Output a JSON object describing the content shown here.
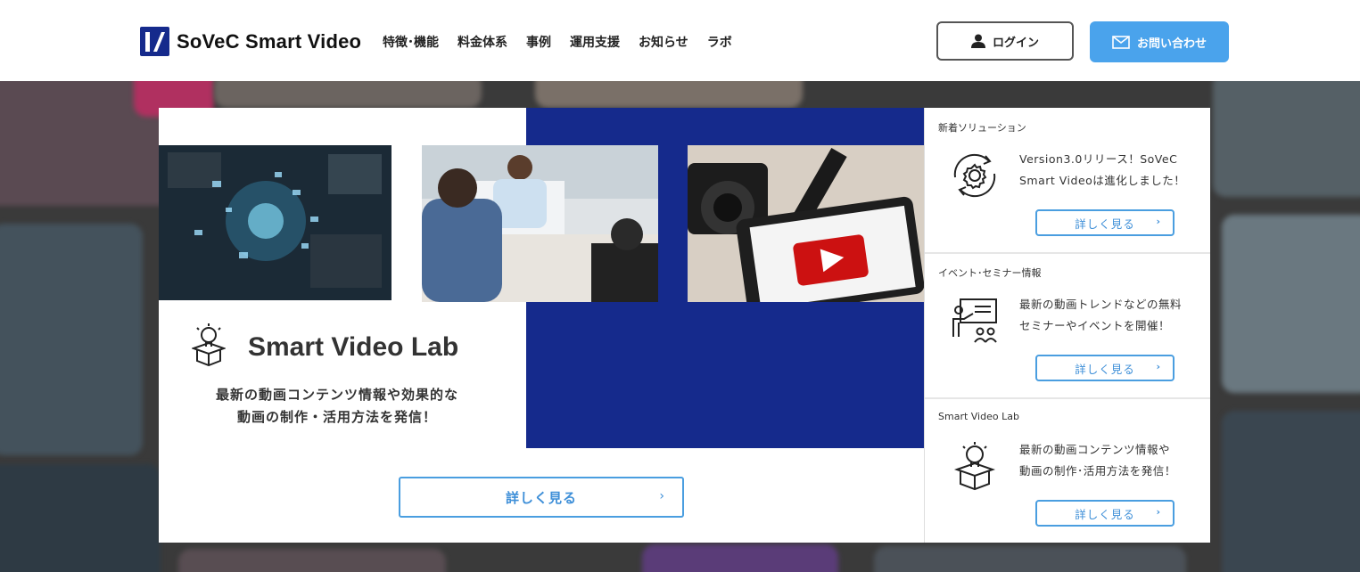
{
  "header": {
    "logo_text": "SoVeC Smart Video",
    "nav": [
      "特徴･機能",
      "料金体系",
      "事例",
      "運用支援",
      "お知らせ",
      "ラボ"
    ],
    "login_label": "ログイン",
    "contact_label": "お問い合わせ"
  },
  "main_card": {
    "title": "Smart Video Lab",
    "desc_line1": "最新の動画コンテンツ情報や効果的な",
    "desc_line2": "動画の制作・活用方法を発信！",
    "more_label": "詳しく見る",
    "chevron": "›"
  },
  "side": [
    {
      "category": "新着ソリューション",
      "text_line1": "Version3.0リリース！SoVeC",
      "text_line2": "Smart Videoは進化しました！",
      "icon": "gear-refresh-icon",
      "more_label": "詳しく見る",
      "chevron": "›"
    },
    {
      "category": "イベント･セミナー情報",
      "text_line1": "最新の動画トレンドなどの無料",
      "text_line2": "セミナーやイベントを開催！",
      "icon": "presentation-icon",
      "more_label": "詳しく見る",
      "chevron": "›"
    },
    {
      "category": "Smart Video Lab",
      "text_line1": "最新の動画コンテンツ情報や",
      "text_line2": "動画の制作･活用方法を発信！",
      "icon": "lightbulb-box-icon",
      "more_label": "詳しく見る",
      "chevron": "›"
    }
  ],
  "colors": {
    "brand_blue": "#152a8c",
    "accent_blue": "#4aa3ec",
    "link_blue": "#3e8fd8"
  }
}
